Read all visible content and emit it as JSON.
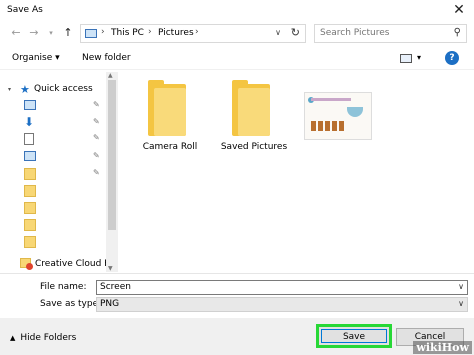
{
  "window": {
    "title": "Save As"
  },
  "address": {
    "crumbs": [
      "This PC",
      "Pictures"
    ]
  },
  "search": {
    "placeholder": "Search Pictures"
  },
  "toolbar": {
    "organise_label": "Organise ▾",
    "new_folder_label": "New folder"
  },
  "sidebar": {
    "quick_access_label": "Quick access",
    "creative_cloud_label": "Creative Cloud Fil"
  },
  "files": [
    {
      "name": "Camera Roll",
      "type": "folder"
    },
    {
      "name": "Saved Pictures",
      "type": "folder"
    },
    {
      "name": "",
      "type": "image"
    }
  ],
  "form": {
    "file_name_label": "File name:",
    "file_name_value": "Screen",
    "save_as_type_label": "Save as type:",
    "save_as_type_value": "PNG"
  },
  "footer": {
    "hide_folders_label": "Hide Folders",
    "save_label": "Save",
    "cancel_label": "Cancel"
  },
  "watermark": "wikiHow",
  "colors": {
    "highlight": "#27d836",
    "accent": "#0078d7",
    "folder": "#f4c542"
  }
}
